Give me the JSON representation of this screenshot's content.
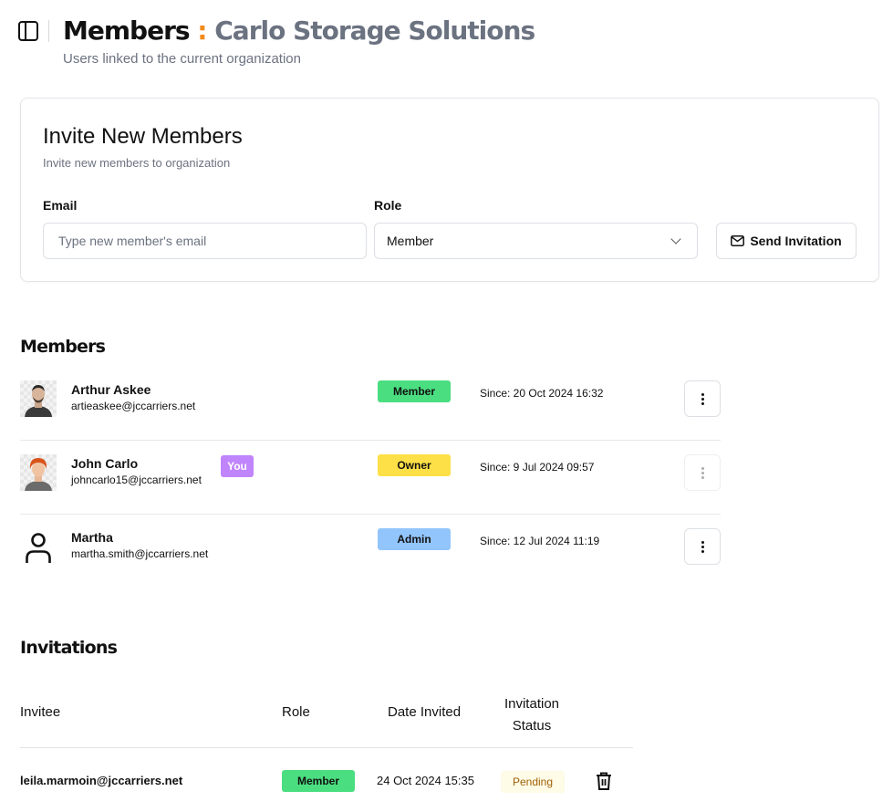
{
  "header": {
    "title": "Members",
    "separator": ":",
    "org_name": "Carlo Storage Solutions",
    "subtitle": "Users linked to the current organization",
    "sidebar_toggle_icon": "sidebar-panel-icon"
  },
  "invite": {
    "title": "Invite New Members",
    "subtitle": "Invite new members to organization",
    "email_label": "Email",
    "email_placeholder": "Type new member's email",
    "email_value": "",
    "role_label": "Role",
    "role_value": "Member",
    "send_label": "Send Invitation",
    "send_icon": "mail-icon"
  },
  "members": {
    "title": "Members",
    "rows": [
      {
        "name": "Arthur Askee",
        "email": "artieaskee@jccarriers.net",
        "role": "Member",
        "role_color": "#4ade80",
        "since": "Since: 20 Oct 2024 16:32",
        "you": "",
        "actions_enabled": true
      },
      {
        "name": "John Carlo",
        "email": "johncarlo15@jccarriers.net",
        "role": "Owner",
        "role_color": "#fde047",
        "since": "Since: 9 Jul 2024 09:57",
        "you": "You",
        "actions_enabled": false
      },
      {
        "name": "Martha",
        "email": "martha.smith@jccarriers.net",
        "role": "Admin",
        "role_color": "#93c5fd",
        "since": "Since: 12 Jul 2024 11:19",
        "you": "",
        "actions_enabled": true
      }
    ]
  },
  "invitations": {
    "title": "Invitations",
    "columns": {
      "invitee": "Invitee",
      "role": "Role",
      "date": "Date Invited",
      "status_line1": "Invitation",
      "status_line2": "Status"
    },
    "rows": [
      {
        "email": "leila.marmoin@jccarriers.net",
        "role": "Member",
        "date": "24 Oct 2024 15:35",
        "status": "Pending"
      }
    ]
  }
}
